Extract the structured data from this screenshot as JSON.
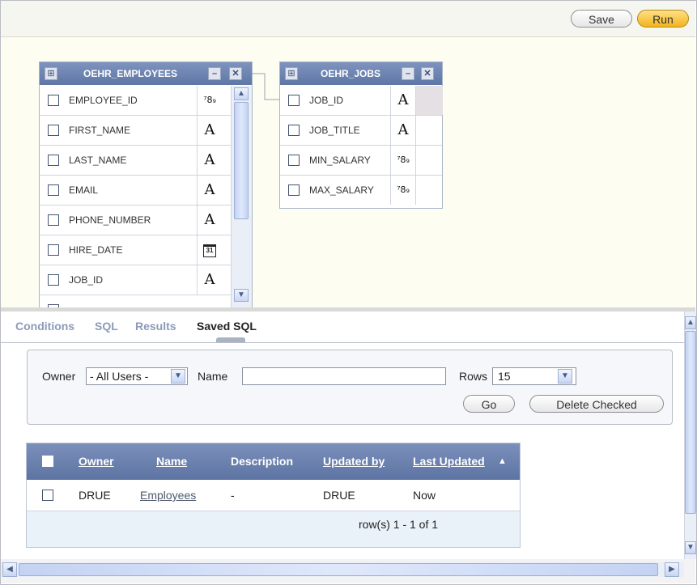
{
  "toolbar": {
    "save_label": "Save",
    "run_label": "Run"
  },
  "tables": {
    "employees": {
      "name": "OEHR_EMPLOYEES",
      "columns": [
        {
          "name": "EMPLOYEE_ID",
          "type": "⁷8₉"
        },
        {
          "name": "FIRST_NAME",
          "type": "A"
        },
        {
          "name": "LAST_NAME",
          "type": "A"
        },
        {
          "name": "EMAIL",
          "type": "A"
        },
        {
          "name": "PHONE_NUMBER",
          "type": "A"
        },
        {
          "name": "HIRE_DATE",
          "type": "31"
        },
        {
          "name": "JOB_ID",
          "type": "A"
        }
      ]
    },
    "jobs": {
      "name": "OEHR_JOBS",
      "columns": [
        {
          "name": "JOB_ID",
          "type": "A"
        },
        {
          "name": "JOB_TITLE",
          "type": "A"
        },
        {
          "name": "MIN_SALARY",
          "type": "⁷8₉"
        },
        {
          "name": "MAX_SALARY",
          "type": "⁷8₉"
        }
      ]
    }
  },
  "tabs": [
    "Conditions",
    "SQL",
    "Results",
    "Saved SQL"
  ],
  "filters": {
    "owner_label": "Owner",
    "owner_value": "- All Users -",
    "name_label": "Name",
    "name_value": "",
    "rows_label": "Rows",
    "rows_value": "15",
    "go_label": "Go",
    "delete_label": "Delete Checked"
  },
  "report": {
    "headers": {
      "owner": "Owner",
      "name": "Name",
      "description": "Description",
      "updated_by": "Updated by",
      "last_updated": "Last Updated"
    },
    "rows": [
      {
        "owner": "DRUE",
        "name": "Employees",
        "description": "-",
        "updated_by": "DRUE",
        "last_updated": "Now"
      }
    ],
    "pager": "row(s) 1 - 1 of 1"
  },
  "colors": {
    "header_blue": "#5f76a6",
    "run_orange": "#f3b41a",
    "canvas_bg": "#fdfdf2"
  }
}
